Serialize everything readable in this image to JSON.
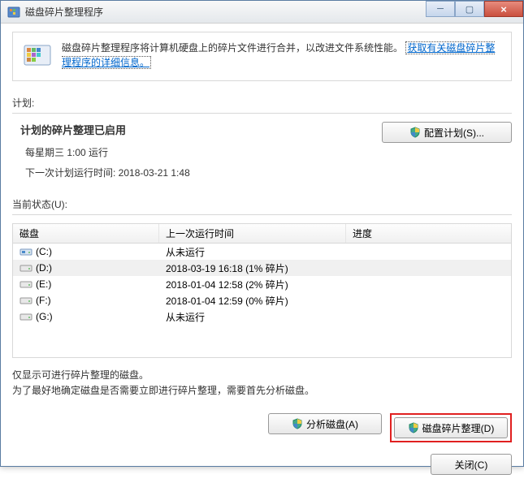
{
  "window": {
    "title": "磁盘碎片整理程序"
  },
  "info": {
    "text": "磁盘碎片整理程序将计算机硬盘上的碎片文件进行合并，以改进文件系统性能。",
    "link": "获取有关磁盘碎片整理程序的详细信息。"
  },
  "schedule": {
    "label": "计划:",
    "title": "计划的碎片整理已启用",
    "frequency": "每星期三  1:00 运行",
    "next_run": "下一次计划运行时间: 2018-03-21 1:48",
    "configure_btn": "配置计划(S)..."
  },
  "status": {
    "label": "当前状态(U):",
    "columns": {
      "disk": "磁盘",
      "lastrun": "上一次运行时间",
      "progress": "进度"
    },
    "rows": [
      {
        "icon": "system-drive",
        "name": "(C:)",
        "lastrun": "从未运行",
        "selected": false
      },
      {
        "icon": "hdd-drive",
        "name": "(D:)",
        "lastrun": "2018-03-19 16:18 (1% 碎片)",
        "selected": true
      },
      {
        "icon": "hdd-drive",
        "name": "(E:)",
        "lastrun": "2018-01-04 12:58 (2% 碎片)",
        "selected": false
      },
      {
        "icon": "hdd-drive",
        "name": "(F:)",
        "lastrun": "2018-01-04 12:59 (0% 碎片)",
        "selected": false
      },
      {
        "icon": "hdd-drive",
        "name": "(G:)",
        "lastrun": "从未运行",
        "selected": false
      }
    ]
  },
  "notes": {
    "line1": "仅显示可进行碎片整理的磁盘。",
    "line2": "为了最好地确定磁盘是否需要立即进行碎片整理，需要首先分析磁盘。"
  },
  "actions": {
    "analyze": "分析磁盘(A)",
    "defrag": "磁盘碎片整理(D)",
    "close": "关闭(C)"
  }
}
